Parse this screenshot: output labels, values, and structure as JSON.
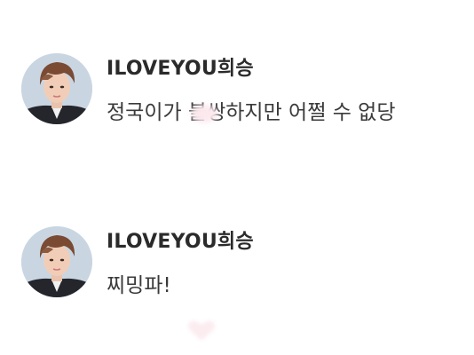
{
  "comments": [
    {
      "username": "ILOVEYOU희승",
      "text": "정국이가 불쌍하지만 어쩔 수 없당",
      "avatar": "profile-photo"
    },
    {
      "username": "ILOVEYOU희승",
      "text": "찌밍파!",
      "avatar": "profile-photo"
    }
  ],
  "colors": {
    "background": "#ffffff",
    "username": "#2b2b2b",
    "text": "#3a3a3a"
  }
}
